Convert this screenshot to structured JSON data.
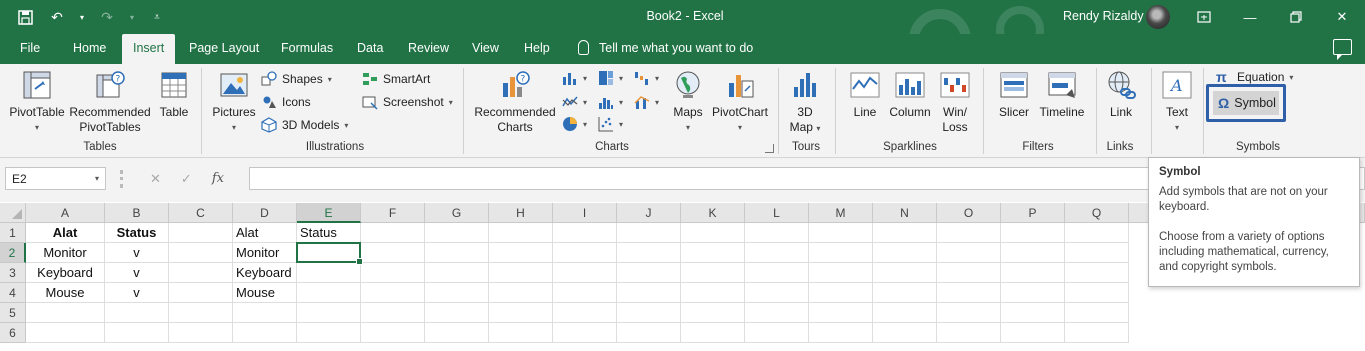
{
  "titlebar": {
    "doc_title": "Book2  -  Excel",
    "user_name": "Rendy Rizaldy",
    "color": "#217346"
  },
  "tabs": [
    "File",
    "Home",
    "Insert",
    "Page Layout",
    "Formulas",
    "Data",
    "Review",
    "View",
    "Help"
  ],
  "active_tab": "Insert",
  "tell_me": "Tell me what you want to do",
  "ribbon": {
    "tables": {
      "label": "Tables",
      "pivot": "PivotTable",
      "rec_pivot_1": "Recommended",
      "rec_pivot_2": "PivotTables",
      "table": "Table"
    },
    "illustrations": {
      "label": "Illustrations",
      "pictures": "Pictures",
      "shapes": "Shapes",
      "icons": "Icons",
      "models": "3D Models",
      "smartart": "SmartArt",
      "screenshot": "Screenshot"
    },
    "charts": {
      "label": "Charts",
      "rec_1": "Recommended",
      "rec_2": "Charts",
      "maps": "Maps",
      "pivotchart": "PivotChart"
    },
    "tours": {
      "label": "Tours",
      "map_1": "3D",
      "map_2": "Map"
    },
    "sparklines": {
      "label": "Sparklines",
      "line": "Line",
      "column": "Column",
      "winloss_1": "Win/",
      "winloss_2": "Loss"
    },
    "filters": {
      "label": "Filters",
      "slicer": "Slicer",
      "timeline": "Timeline"
    },
    "links": {
      "label": "Links",
      "link": "Link"
    },
    "text": {
      "label": "Text",
      "text": "Text"
    },
    "symbols": {
      "label": "Symbols",
      "equation": "Equation",
      "symbol": "Symbol"
    }
  },
  "formula_bar": {
    "name_box": "E2",
    "fx": "fx",
    "value": ""
  },
  "sheet": {
    "columns": [
      "A",
      "B",
      "C",
      "D",
      "E",
      "F",
      "G",
      "H",
      "I",
      "J",
      "K",
      "L",
      "M",
      "N",
      "O",
      "P",
      "Q"
    ],
    "rows": [
      "1",
      "2",
      "3",
      "4",
      "5",
      "6"
    ],
    "cells": {
      "A1": "Alat",
      "B1": "Status",
      "D1": "Alat",
      "E1": "Status",
      "A2": "Monitor",
      "B2": "v",
      "D2": "Monitor",
      "A3": "Keyboard",
      "B3": "v",
      "D3": "Keyboard",
      "A4": "Mouse",
      "B4": "v",
      "D4": "Mouse"
    },
    "active_cell": "E2"
  },
  "tooltip": {
    "title": "Symbol",
    "line1": "Add symbols that are not on your keyboard.",
    "line2": "Choose from a variety of options including mathematical, currency, and copyright symbols."
  }
}
